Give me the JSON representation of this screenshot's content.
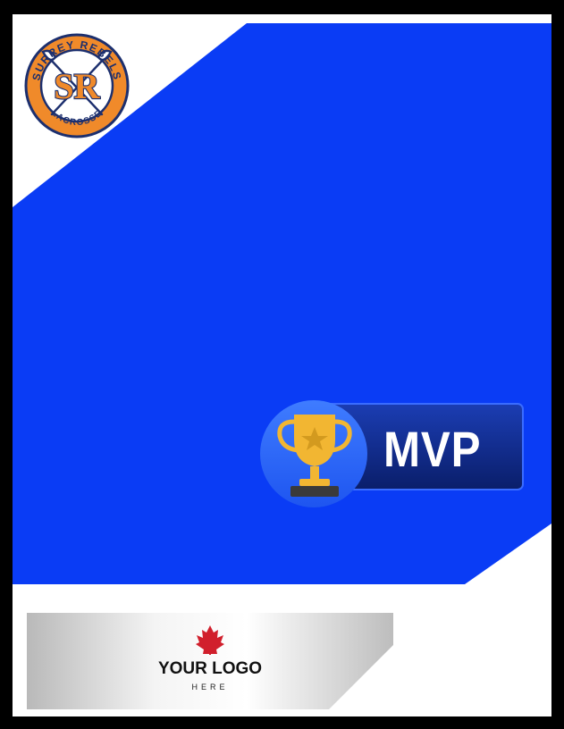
{
  "team_logo": {
    "arc_top": "SURREY REBELS",
    "monogram": "SR",
    "arc_bottom": "LACROSSE"
  },
  "award": {
    "label": "MVP"
  },
  "sponsor": {
    "title": "YOUR LOGO",
    "subtitle": "HERE"
  },
  "colors": {
    "frame": "#000000",
    "card_blue": "#0a3cf5",
    "logo_orange": "#f08a2a",
    "logo_navy": "#1c2f6e",
    "badge_navy": "#0d2a8a",
    "trophy_gold": "#f2b632",
    "maple_red": "#d11f2c"
  },
  "icons": {
    "trophy": "trophy-icon",
    "maple": "maple-leaf-icon",
    "lacrosse": "lacrosse-sticks-icon"
  }
}
